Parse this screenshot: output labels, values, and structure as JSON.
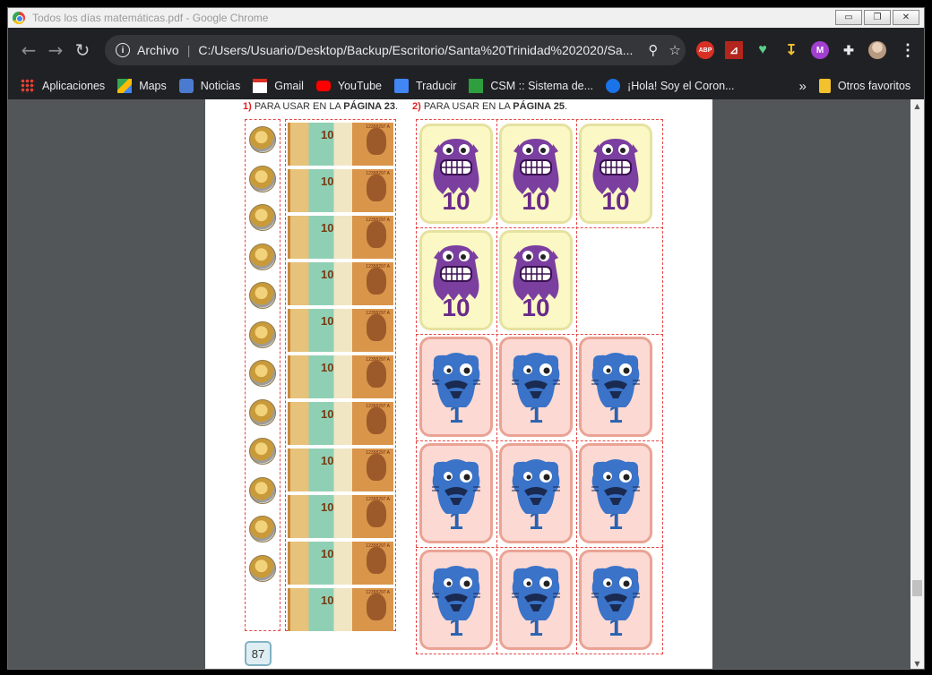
{
  "window": {
    "title": "Todos los días matemáticas.pdf - Google Chrome",
    "buttons": {
      "minimize": "▭",
      "restore": "❐",
      "close": "✕"
    }
  },
  "toolbar": {
    "back": "←",
    "forward": "→",
    "reload": "↻",
    "info": "i",
    "scheme_label": "Archivo",
    "separator": "|",
    "url": "C:/Users/Usuario/Desktop/Backup/Escritorio/Santa%20Trinidad%202020/Sa...",
    "zoom": "⚲",
    "star": "☆",
    "menu": "⋮"
  },
  "extensions": [
    {
      "name": "adblock-plus-icon",
      "label": "ABP"
    },
    {
      "name": "pdf-icon",
      "label": "⊿"
    },
    {
      "name": "heart-icon",
      "label": "♥"
    },
    {
      "name": "yellow-arrow-icon",
      "label": "↧"
    },
    {
      "name": "purple-m-icon",
      "label": "M"
    },
    {
      "name": "puzzle-icon",
      "label": "✚"
    },
    {
      "name": "profile-avatar-icon",
      "label": ""
    }
  ],
  "bookmarks": [
    {
      "label": "Aplicaciones",
      "color": "#e94235"
    },
    {
      "label": "Maps",
      "color": "#34a853"
    },
    {
      "label": "Noticias",
      "color": "#4a7bd0"
    },
    {
      "label": "Gmail",
      "color": "#d93025"
    },
    {
      "label": "YouTube",
      "color": "#ff0000"
    },
    {
      "label": "Traducir",
      "color": "#4285f4"
    },
    {
      "label": "CSM :: Sistema de...",
      "color": "#2e9e3e"
    },
    {
      "label": "¡Hola! Soy el Coron...",
      "color": "#1a73e8"
    }
  ],
  "bookmarks_overflow": "»",
  "other_bookmarks": "Otros favoritos",
  "document": {
    "heading1": {
      "num": "1)",
      "prefix": "PARA USAR EN LA ",
      "bold": "PÁGINA 23",
      "suffix": "."
    },
    "heading2": {
      "num": "2)",
      "prefix": "PARA USAR EN LA ",
      "bold": "PÁGINA 25",
      "suffix": "."
    },
    "bill_value": "10",
    "bill_serial": "12358297 A",
    "purple_card_value": "10",
    "blue_card_value": "1",
    "page_number": "87",
    "coin_count": 12,
    "bill_count": 11,
    "purple_card_count": 5,
    "blue_card_count": 9
  },
  "colors": {
    "dash": "#e54646",
    "purple_card_bg": "#fbf8c5",
    "blue_card_bg": "#fcd9d3",
    "purple_monster": "#7b3fa0",
    "blue_monster": "#3a73c8"
  }
}
